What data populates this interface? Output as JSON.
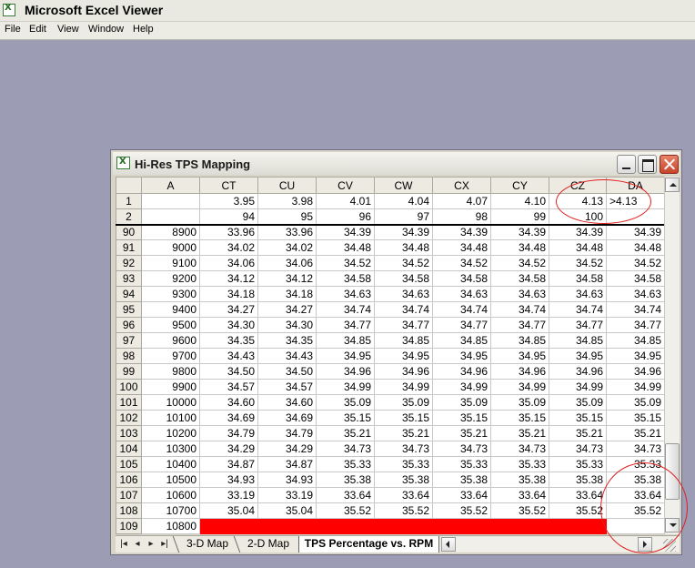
{
  "app": {
    "title": "Microsoft Excel Viewer",
    "menu": [
      "File",
      "Edit",
      "View",
      "Window",
      "Help"
    ]
  },
  "document": {
    "title": "Hi-Res TPS Mapping"
  },
  "grid": {
    "columns": [
      "A",
      "CT",
      "CU",
      "CV",
      "CW",
      "CX",
      "CY",
      "CZ",
      "DA"
    ],
    "header_rows": [
      {
        "row": "1",
        "cells": [
          "",
          "3.95",
          "3.98",
          "4.01",
          "4.04",
          "4.07",
          "4.10",
          "4.13",
          ">4.13"
        ]
      },
      {
        "row": "2",
        "cells": [
          "",
          "94",
          "95",
          "96",
          "97",
          "98",
          "99",
          "100",
          ""
        ]
      }
    ],
    "rows": [
      {
        "row": "90",
        "cells": [
          "8900",
          "33.96",
          "33.96",
          "34.39",
          "34.39",
          "34.39",
          "34.39",
          "34.39",
          "34.39"
        ]
      },
      {
        "row": "91",
        "cells": [
          "9000",
          "34.02",
          "34.02",
          "34.48",
          "34.48",
          "34.48",
          "34.48",
          "34.48",
          "34.48"
        ]
      },
      {
        "row": "92",
        "cells": [
          "9100",
          "34.06",
          "34.06",
          "34.52",
          "34.52",
          "34.52",
          "34.52",
          "34.52",
          "34.52"
        ]
      },
      {
        "row": "93",
        "cells": [
          "9200",
          "34.12",
          "34.12",
          "34.58",
          "34.58",
          "34.58",
          "34.58",
          "34.58",
          "34.58"
        ]
      },
      {
        "row": "94",
        "cells": [
          "9300",
          "34.18",
          "34.18",
          "34.63",
          "34.63",
          "34.63",
          "34.63",
          "34.63",
          "34.63"
        ]
      },
      {
        "row": "95",
        "cells": [
          "9400",
          "34.27",
          "34.27",
          "34.74",
          "34.74",
          "34.74",
          "34.74",
          "34.74",
          "34.74"
        ]
      },
      {
        "row": "96",
        "cells": [
          "9500",
          "34.30",
          "34.30",
          "34.77",
          "34.77",
          "34.77",
          "34.77",
          "34.77",
          "34.77"
        ]
      },
      {
        "row": "97",
        "cells": [
          "9600",
          "34.35",
          "34.35",
          "34.85",
          "34.85",
          "34.85",
          "34.85",
          "34.85",
          "34.85"
        ]
      },
      {
        "row": "98",
        "cells": [
          "9700",
          "34.43",
          "34.43",
          "34.95",
          "34.95",
          "34.95",
          "34.95",
          "34.95",
          "34.95"
        ]
      },
      {
        "row": "99",
        "cells": [
          "9800",
          "34.50",
          "34.50",
          "34.96",
          "34.96",
          "34.96",
          "34.96",
          "34.96",
          "34.96"
        ]
      },
      {
        "row": "100",
        "cells": [
          "9900",
          "34.57",
          "34.57",
          "34.99",
          "34.99",
          "34.99",
          "34.99",
          "34.99",
          "34.99"
        ]
      },
      {
        "row": "101",
        "cells": [
          "10000",
          "34.60",
          "34.60",
          "35.09",
          "35.09",
          "35.09",
          "35.09",
          "35.09",
          "35.09"
        ]
      },
      {
        "row": "102",
        "cells": [
          "10100",
          "34.69",
          "34.69",
          "35.15",
          "35.15",
          "35.15",
          "35.15",
          "35.15",
          "35.15"
        ]
      },
      {
        "row": "103",
        "cells": [
          "10200",
          "34.79",
          "34.79",
          "35.21",
          "35.21",
          "35.21",
          "35.21",
          "35.21",
          "35.21"
        ]
      },
      {
        "row": "104",
        "cells": [
          "10300",
          "34.29",
          "34.29",
          "34.73",
          "34.73",
          "34.73",
          "34.73",
          "34.73",
          "34.73"
        ]
      },
      {
        "row": "105",
        "cells": [
          "10400",
          "34.87",
          "34.87",
          "35.33",
          "35.33",
          "35.33",
          "35.33",
          "35.33",
          "35.33"
        ]
      },
      {
        "row": "106",
        "cells": [
          "10500",
          "34.93",
          "34.93",
          "35.38",
          "35.38",
          "35.38",
          "35.38",
          "35.38",
          "35.38"
        ]
      },
      {
        "row": "107",
        "cells": [
          "10600",
          "33.19",
          "33.19",
          "33.64",
          "33.64",
          "33.64",
          "33.64",
          "33.64",
          "33.64"
        ]
      },
      {
        "row": "108",
        "cells": [
          "10700",
          "35.04",
          "35.04",
          "35.52",
          "35.52",
          "35.52",
          "35.52",
          "35.52",
          "35.52"
        ]
      }
    ],
    "last_row": {
      "row": "109",
      "a": "10800"
    }
  },
  "sheets": {
    "tabs": [
      "3-D Map",
      "2-D Map",
      "TPS Percentage vs. RPM"
    ],
    "active": "TPS Percentage vs. RPM"
  },
  "colors": {
    "desktop": "#9c9cb4",
    "highlight_fill": "#ff0000",
    "annotation": "#e02020"
  }
}
